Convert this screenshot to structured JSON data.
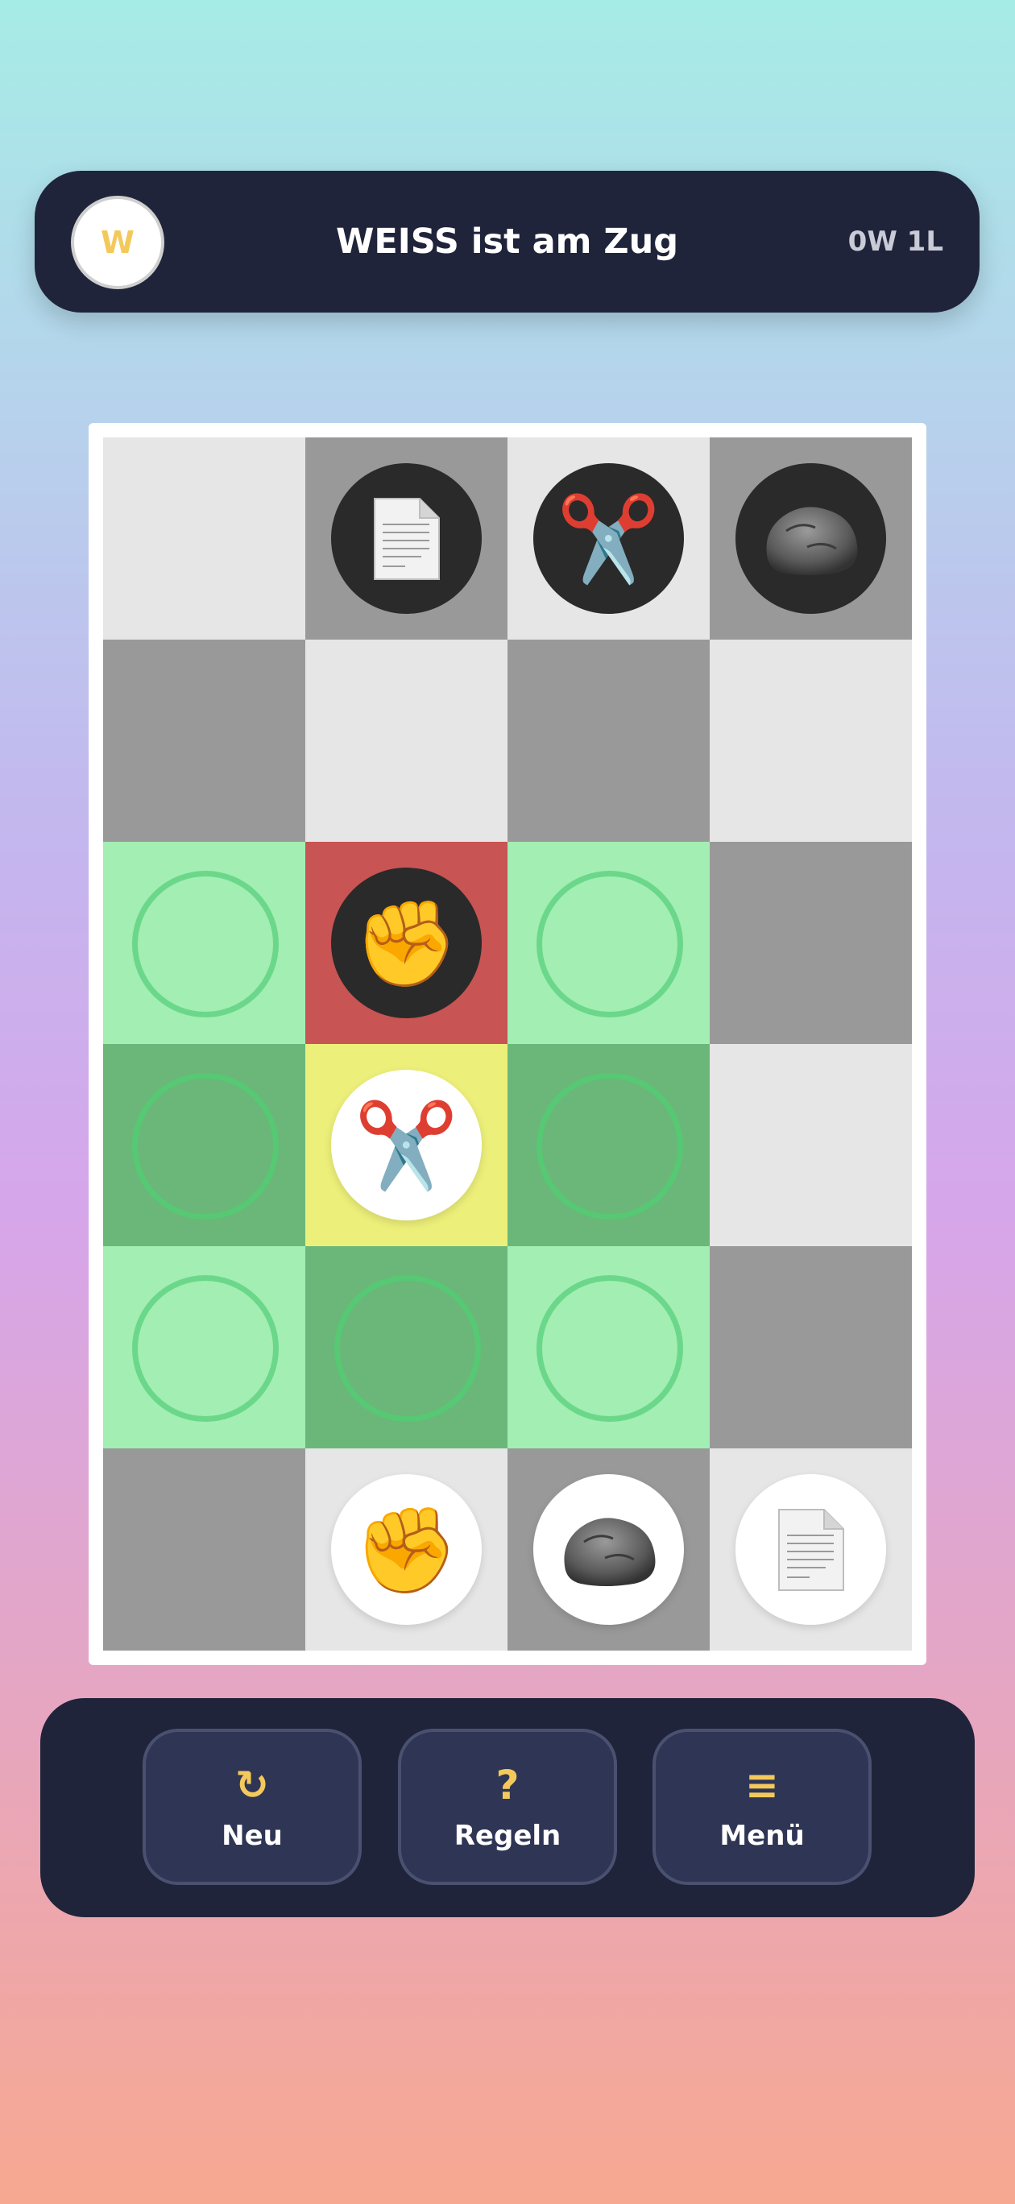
{
  "header": {
    "avatar_letter": "W",
    "turn_text": "WEISS ist am Zug",
    "score": "0W 1L"
  },
  "board": {
    "rows": 6,
    "cols": 4,
    "cells": [
      [
        {
          "state": "light"
        },
        {
          "state": "dark",
          "piece": {
            "color": "black",
            "type": "paper"
          }
        },
        {
          "state": "light",
          "piece": {
            "color": "black",
            "type": "scissors"
          }
        },
        {
          "state": "dark",
          "piece": {
            "color": "black",
            "type": "rock"
          }
        }
      ],
      [
        {
          "state": "dark"
        },
        {
          "state": "light"
        },
        {
          "state": "dark"
        },
        {
          "state": "light"
        }
      ],
      [
        {
          "state": "move-light"
        },
        {
          "state": "enemy",
          "piece": {
            "color": "black",
            "type": "fist"
          }
        },
        {
          "state": "move-light"
        },
        {
          "state": "dark"
        }
      ],
      [
        {
          "state": "move-dark"
        },
        {
          "state": "selected",
          "piece": {
            "color": "white",
            "type": "scissors"
          }
        },
        {
          "state": "move-dark"
        },
        {
          "state": "light"
        }
      ],
      [
        {
          "state": "move-light"
        },
        {
          "state": "move-dark"
        },
        {
          "state": "move-light"
        },
        {
          "state": "dark"
        }
      ],
      [
        {
          "state": "dark"
        },
        {
          "state": "light",
          "piece": {
            "color": "white",
            "type": "fist"
          }
        },
        {
          "state": "dark",
          "piece": {
            "color": "white",
            "type": "rock"
          }
        },
        {
          "state": "light",
          "piece": {
            "color": "white",
            "type": "paper"
          }
        }
      ]
    ]
  },
  "toolbar": {
    "buttons": [
      {
        "label": "Neu",
        "icon": "restart-icon",
        "glyph": "↻"
      },
      {
        "label": "Regeln",
        "icon": "help-icon",
        "glyph": "?"
      },
      {
        "label": "Menü",
        "icon": "menu-icon",
        "glyph": "≡"
      }
    ]
  },
  "colors": {
    "accent": "#f4c95b",
    "panel": "#20243a",
    "button": "#2f3554"
  }
}
